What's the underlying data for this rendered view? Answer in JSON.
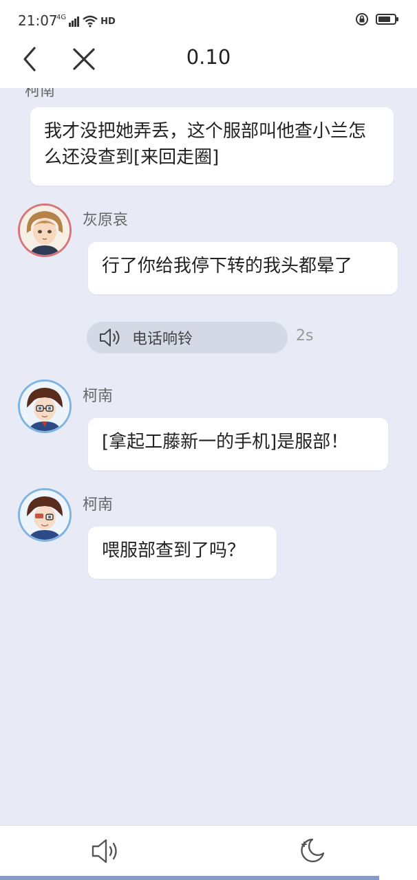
{
  "status_bar": {
    "time": "21:07",
    "network": "4G",
    "hd": "HD"
  },
  "header": {
    "title": "0.10"
  },
  "messages": [
    {
      "sender": "柯南",
      "text": "我才没把她弄丢，这个服部叫他查小兰怎么还没查到[来回走圈]"
    },
    {
      "sender": "灰原哀",
      "text": "行了你给我停下转的我头都晕了"
    },
    {
      "type": "voice",
      "label": "电话响铃",
      "duration": "2s"
    },
    {
      "sender": "柯南",
      "text": "[拿起工藤新一的手机]是服部！"
    },
    {
      "sender": "柯南",
      "text": "喂服部查到了吗？"
    }
  ],
  "progress": 0.91,
  "colors": {
    "chat_background": "#e8eaf6",
    "bubble": "#ffffff",
    "avatar_ring_pink": "#d9737a",
    "avatar_ring_blue": "#7fb3e0"
  },
  "icons": {
    "back": "back-arrow-icon",
    "close": "close-icon",
    "speaker": "speaker-icon",
    "night": "night-mode-icon"
  }
}
